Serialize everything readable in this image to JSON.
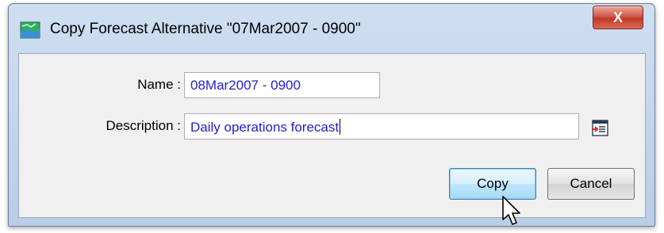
{
  "window": {
    "title": "Copy Forecast Alternative \"07Mar2007 - 0900\"",
    "close_label": "X"
  },
  "form": {
    "name_label": "Name :",
    "name_value": "08Mar2007 - 0900",
    "description_label": "Description :",
    "description_value": "Daily operations forecast"
  },
  "buttons": {
    "copy": "Copy",
    "cancel": "Cancel"
  },
  "icons": {
    "app": "forecast-map-icon",
    "browse": "description-editor-icon",
    "cursor": "mouse-pointer-icon"
  }
}
